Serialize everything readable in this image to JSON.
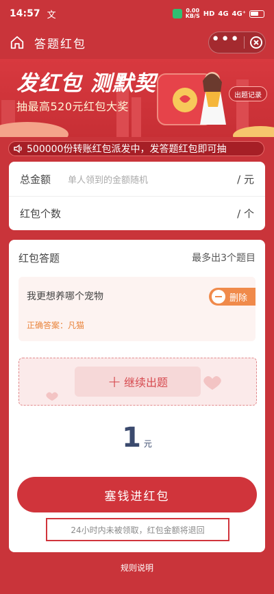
{
  "status_bar": {
    "time": "14:57",
    "app_glyph": "文",
    "net_speed_value": "0.00",
    "net_speed_unit": "KB/S",
    "hd": "HD",
    "sim1": "4G",
    "sim2": "4G⁺"
  },
  "nav": {
    "title": "答题红包",
    "more_icon": "more-dots-icon",
    "close_icon": "close-circle-icon"
  },
  "banner": {
    "title": "发红包 测默契",
    "subtitle": "抽最高520元红包大奖",
    "history_button": "出题记录"
  },
  "notice": {
    "text": "500000份转账红包派发中，发答题红包即可抽"
  },
  "amount_card": {
    "total_label": "总金额",
    "total_placeholder": "单人领到的金额随机",
    "total_unit": "/ 元",
    "count_label": "红包个数",
    "count_unit": "/ 个"
  },
  "question_card": {
    "title": "红包答题",
    "max_note": "最多出3个题目",
    "questions": [
      {
        "text": "我更想养哪个宠物",
        "delete_label": "删除",
        "answer": "正确答案：凡猫"
      }
    ],
    "add_label": "继续出题",
    "amount_value": "1",
    "amount_unit": "元",
    "submit_label": "塞钱进红包",
    "refund_note": "24小时内未被领取，红包金额将退回"
  },
  "footer": {
    "rules_link": "规则说明"
  },
  "colors": {
    "background": "#c9343a",
    "button": "#d0343b",
    "delete_button": "#f08a4b",
    "amount_text": "#3b4a6e"
  }
}
